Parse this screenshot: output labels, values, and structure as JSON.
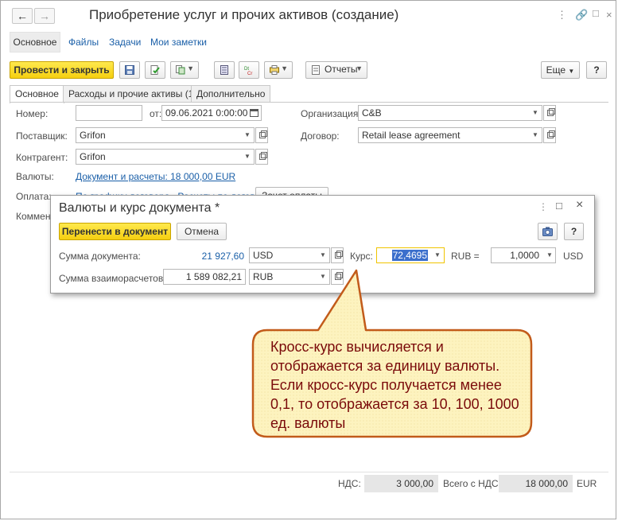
{
  "window": {
    "title": "Приобретение услуг и прочих активов (создание)",
    "back_icon": "arrow-left-icon",
    "forward_icon": "arrow-right-icon",
    "menu_icon": "more-icon",
    "link_icon": "link-icon",
    "minimize_icon": "minimize-icon",
    "close_icon": "close-icon"
  },
  "nav": {
    "tabs": [
      "Основное",
      "Файлы",
      "Задачи",
      "Мои заметки"
    ]
  },
  "toolbar": {
    "post_close_label": "Провести и закрыть",
    "reports_label": "Отчеты",
    "more_label": "Еще",
    "help_label": "?"
  },
  "form_tabs": [
    "Основное",
    "Расходы и прочие активы (1)",
    "Дополнительно"
  ],
  "form": {
    "number_label": "Номер:",
    "number_value": "",
    "date_label": "от:",
    "date_value": "09.06.2021 0:00:00",
    "org_label": "Организация:",
    "org_value": "C&B",
    "supplier_label": "Поставщик:",
    "supplier_value": "Grifon",
    "contract_label": "Договор:",
    "contract_value": "Retail lease agreement",
    "counterparty_label": "Контрагент:",
    "counterparty_value": "Grifon",
    "currency_label": "Валюты:",
    "currency_link": "Документ и расчеты: 18 000,00 EUR",
    "payment_label": "Оплата:",
    "payment_link": "По графику договора , Расчеты по договору",
    "payment_button": "Зачет оплаты",
    "comment_label": "Коммент"
  },
  "totals": {
    "vat_label": "НДС:",
    "vat_value": "3 000,00",
    "total_label": "Всего с НДС:",
    "total_value": "18 000,00",
    "currency": "EUR"
  },
  "dialog": {
    "title": "Валюты и курс документа *",
    "transfer_label": "Перенести в документ",
    "cancel_label": "Отмена",
    "help_label": "?",
    "doc_sum_label": "Сумма документа:",
    "doc_sum_value": "21 927,60",
    "doc_currency": "USD",
    "rate_label": "Курс:",
    "rate_value": "72,4695",
    "rub_eq_label": "RUB =",
    "per_value": "1,0000",
    "per_currency": "USD",
    "settle_label": "Сумма взаиморасчетов:",
    "settle_value": "1 589 082,21",
    "settle_currency": "RUB"
  },
  "callout": {
    "text": "Кросс-курс вычисляется и отображается за единицу валюты. Если кросс-курс получается менее 0,1, то отображается за 10, 100, 1000 ед. валюты",
    "fill": "#fdf3bf",
    "stroke": "#c25b1a",
    "text_color": "#7a0a0a"
  },
  "colors": {
    "accent_yellow": "#f5cf10",
    "link_blue": "#1a5fa8"
  }
}
